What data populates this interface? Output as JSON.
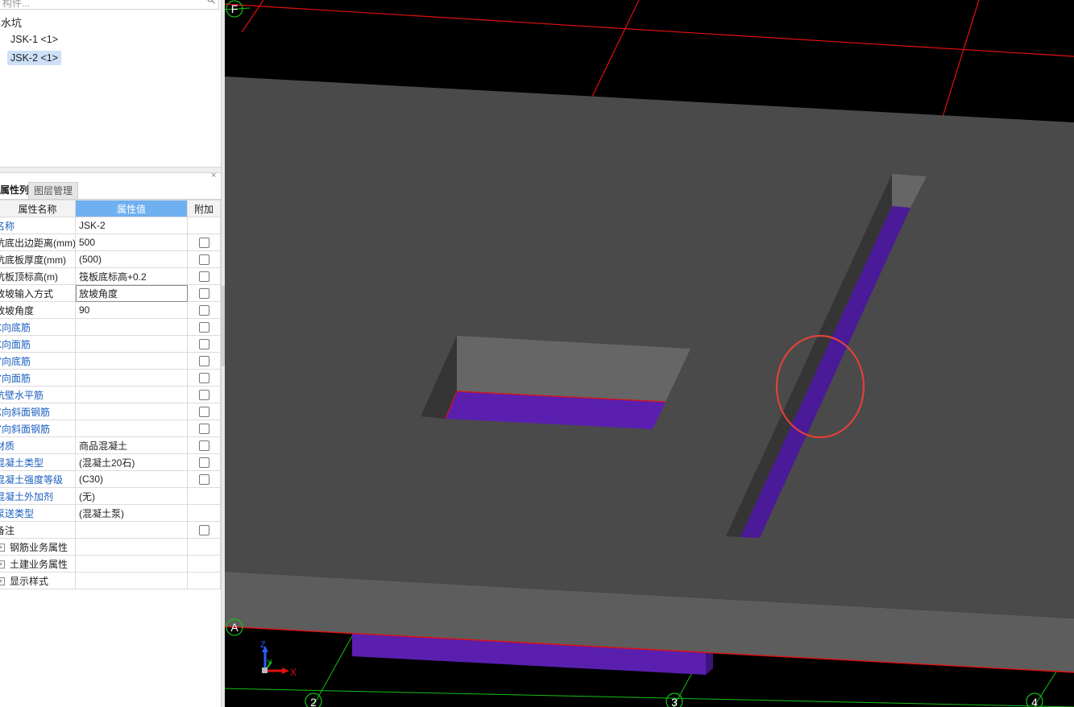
{
  "search": {
    "placeholder_visible": "构件..."
  },
  "tree": {
    "root_label": "集水坑",
    "items": [
      {
        "label": "JSK-1 <1>",
        "selected": false
      },
      {
        "label": "JSK-2 <1>",
        "selected": true
      }
    ]
  },
  "panel": {
    "close_glyph": "×",
    "tabs": [
      {
        "label": "属性列表",
        "active": true
      },
      {
        "label": "图层管理",
        "active": false
      }
    ],
    "columns": {
      "name": "属性名称",
      "value": "属性值",
      "extra": "附加"
    }
  },
  "properties": [
    {
      "name": "名称",
      "value": "JSK-2",
      "checkbox": false,
      "color": "blue"
    },
    {
      "name": "坑底出边距离(mm)",
      "value": "500",
      "checkbox": true,
      "color": "black"
    },
    {
      "name": "坑底板厚度(mm)",
      "value": "(500)",
      "checkbox": true,
      "color": "black"
    },
    {
      "name": "坑板顶标高(m)",
      "value": "筏板底标高+0.2",
      "checkbox": true,
      "color": "black"
    },
    {
      "name": "放坡输入方式",
      "value": "放坡角度",
      "checkbox": true,
      "color": "black",
      "editing": true
    },
    {
      "name": "放坡角度",
      "value": "90",
      "checkbox": true,
      "color": "black"
    },
    {
      "name": "X向底筋",
      "value": "",
      "checkbox": true,
      "color": "blue"
    },
    {
      "name": "X向面筋",
      "value": "",
      "checkbox": true,
      "color": "blue"
    },
    {
      "name": "Y向底筋",
      "value": "",
      "checkbox": true,
      "color": "blue"
    },
    {
      "name": "Y向面筋",
      "value": "",
      "checkbox": true,
      "color": "blue"
    },
    {
      "name": "坑壁水平筋",
      "value": "",
      "checkbox": true,
      "color": "blue"
    },
    {
      "name": "X向斜面钢筋",
      "value": "",
      "checkbox": true,
      "color": "blue"
    },
    {
      "name": "Y向斜面钢筋",
      "value": "",
      "checkbox": true,
      "color": "blue"
    },
    {
      "name": "材质",
      "value": "商品混凝土",
      "checkbox": true,
      "color": "blue"
    },
    {
      "name": "混凝土类型",
      "value": "(混凝土20石)",
      "checkbox": true,
      "color": "blue"
    },
    {
      "name": "混凝土强度等级",
      "value": "(C30)",
      "checkbox": true,
      "color": "blue"
    },
    {
      "name": "混凝土外加剂",
      "value": "(无)",
      "checkbox": false,
      "color": "blue"
    },
    {
      "name": "泵送类型",
      "value": "(混凝土泵)",
      "checkbox": false,
      "color": "blue"
    },
    {
      "name": "备注",
      "value": "",
      "checkbox": true,
      "color": "black"
    }
  ],
  "groups": [
    {
      "label": "钢筋业务属性",
      "expand_glyph": "+"
    },
    {
      "label": "土建业务属性",
      "expand_glyph": "+"
    },
    {
      "label": "显示样式",
      "expand_glyph": "+"
    }
  ],
  "viewport": {
    "axis_labels": {
      "top_left": "F",
      "bottom_left": "A",
      "bottom": [
        "2",
        "3",
        "4"
      ]
    },
    "triad": {
      "z": "Z",
      "y": "Y",
      "x": "X"
    },
    "colors": {
      "background": "#000000",
      "slab_top": "#4a4a4a",
      "slab_front": "#5d5d5d",
      "pit_wall_light": "#666666",
      "pit_wall_dark": "#353535",
      "pit_bottom": "#5b1fb0",
      "grid_red": "#e01010",
      "grid_green": "#15c015",
      "annotation_circle": "#e0413a"
    }
  }
}
